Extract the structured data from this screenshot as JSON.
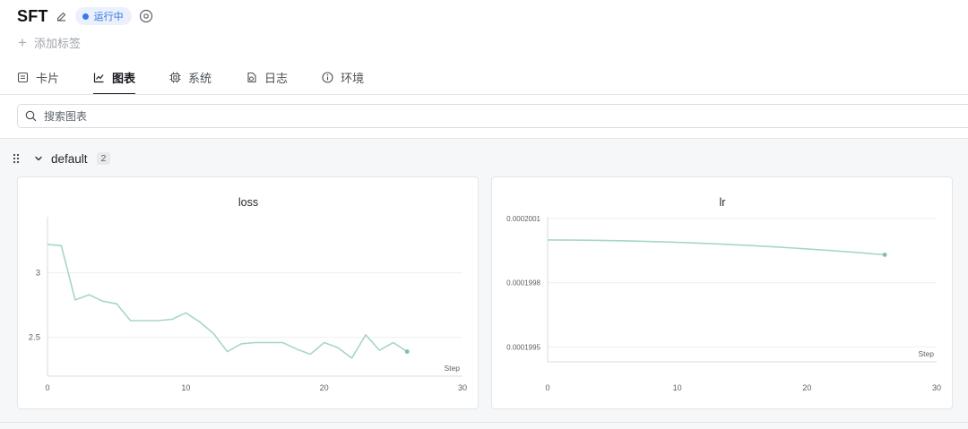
{
  "header": {
    "title": "SFT",
    "status": "运行中",
    "add_tag": "添加标签"
  },
  "tabs": [
    {
      "label": "卡片",
      "icon": "card-icon"
    },
    {
      "label": "图表",
      "icon": "line-chart-icon",
      "active": true
    },
    {
      "label": "系统",
      "icon": "chip-icon"
    },
    {
      "label": "日志",
      "icon": "log-icon"
    },
    {
      "label": "环境",
      "icon": "info-icon"
    }
  ],
  "search": {
    "placeholder": "搜索图表"
  },
  "group": {
    "name": "default",
    "count": "2"
  },
  "colors": {
    "accent": "#3b78e7",
    "series": "#a7d6c4",
    "grid": "#eeeff1",
    "axis": "#d9dbde"
  },
  "chart_data": [
    {
      "type": "line",
      "title": "loss",
      "xlabel": "Step",
      "xlim": [
        0,
        30
      ],
      "ylim": [
        2.2,
        3.42
      ],
      "xticks": [
        "0",
        "10",
        "20",
        "30"
      ],
      "yticks": [
        {
          "value": 3,
          "label": "3"
        },
        {
          "value": 2.5,
          "label": "2.5"
        }
      ],
      "series": [
        {
          "x": [
            0,
            1,
            2,
            3,
            4,
            5,
            6,
            7,
            8,
            9,
            10,
            11,
            12,
            13,
            14,
            15,
            16,
            17,
            18,
            19,
            20,
            21,
            22,
            23,
            24,
            25,
            26
          ],
          "y": [
            3.22,
            3.21,
            2.79,
            2.83,
            2.78,
            2.76,
            2.63,
            2.63,
            2.63,
            2.64,
            2.69,
            2.62,
            2.53,
            2.39,
            2.45,
            2.46,
            2.46,
            2.46,
            2.41,
            2.37,
            2.46,
            2.42,
            2.34,
            2.52,
            2.4,
            2.46,
            2.39
          ]
        }
      ]
    },
    {
      "type": "line",
      "title": "lr",
      "xlabel": "Step",
      "xlim": [
        0,
        30
      ],
      "ylim": [
        0.00019943,
        0.0002001
      ],
      "xticks": [
        "0",
        "10",
        "20",
        "30"
      ],
      "yticks": [
        {
          "value": 0.0002001,
          "label": "0.0002001"
        },
        {
          "value": 0.0001998,
          "label": "0.0001998"
        },
        {
          "value": 0.0001995,
          "label": "0.0001995"
        }
      ],
      "series": [
        {
          "x": [
            0,
            2,
            4,
            6,
            8,
            10,
            12,
            14,
            16,
            18,
            20,
            22,
            24,
            26
          ],
          "y": [
            0.00019999996,
            0.00019999926,
            0.00019999779,
            0.00019999555,
            0.00019999252,
            0.00019998872,
            0.00019998415,
            0.0001999788,
            0.00019997268,
            0.00019996578,
            0.00019995811,
            0.00019994967,
            0.00019994045,
            0.00019993046
          ]
        }
      ]
    }
  ]
}
